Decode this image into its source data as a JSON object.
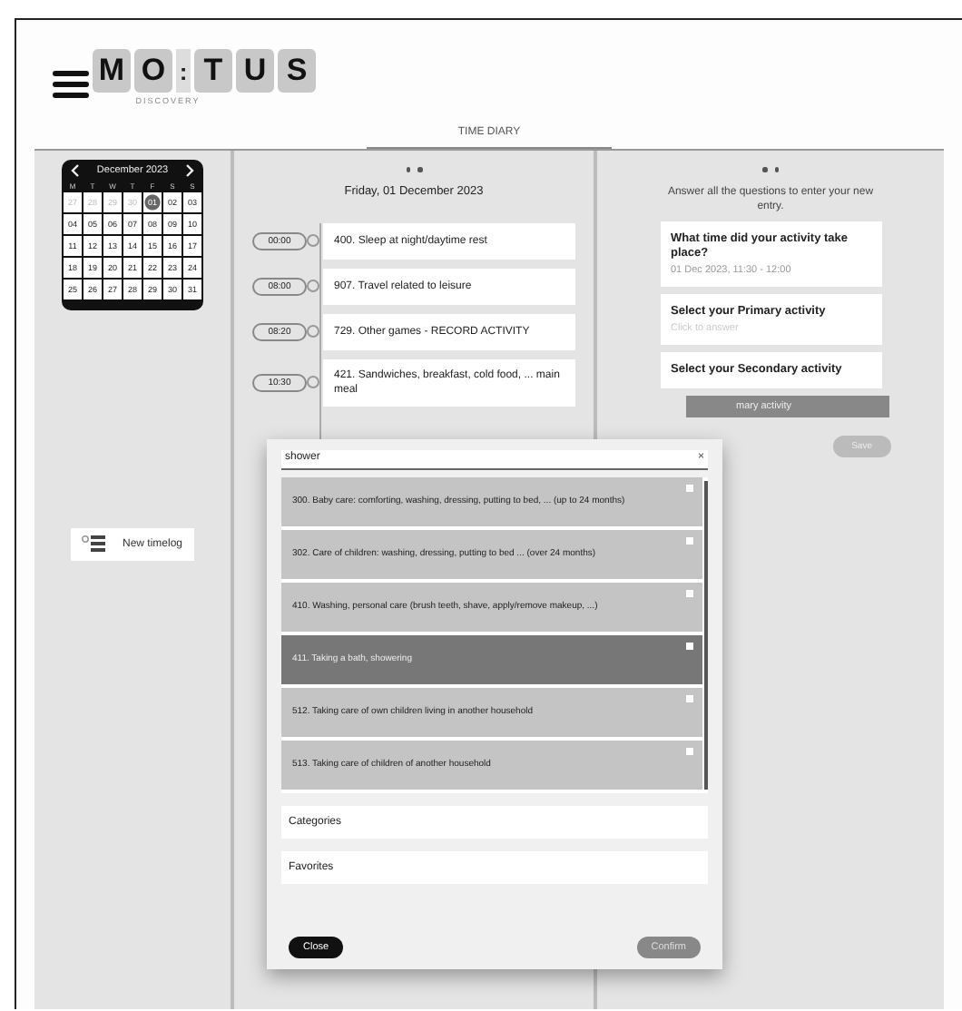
{
  "header": {
    "logo": [
      {
        "kind": "tile",
        "text": "M"
      },
      {
        "kind": "tile",
        "text": "O"
      },
      {
        "kind": "sep",
        "text": ":"
      },
      {
        "kind": "tile",
        "text": "T"
      },
      {
        "kind": "tile",
        "text": "U"
      },
      {
        "kind": "tile",
        "text": "S"
      }
    ],
    "tagline": "DISCOVERY"
  },
  "tabs": [
    {
      "label": "TIME DIARY",
      "selected": true
    }
  ],
  "calendar": {
    "month": "December 2023",
    "weekdays": [
      "M",
      "T",
      "W",
      "T",
      "F",
      "S",
      "S"
    ],
    "weeks": [
      [
        {
          "day": "27",
          "outside": true,
          "selected": false
        },
        {
          "day": "28",
          "outside": true,
          "selected": false
        },
        {
          "day": "29",
          "outside": true,
          "selected": false
        },
        {
          "day": "30",
          "outside": true,
          "selected": false
        },
        {
          "day": "01",
          "outside": false,
          "selected": true
        },
        {
          "day": "02",
          "outside": false,
          "selected": false
        },
        {
          "day": "03",
          "outside": false,
          "selected": false
        }
      ],
      [
        {
          "day": "04",
          "outside": false,
          "selected": false
        },
        {
          "day": "05",
          "outside": false,
          "selected": false
        },
        {
          "day": "06",
          "outside": false,
          "selected": false
        },
        {
          "day": "07",
          "outside": false,
          "selected": false
        },
        {
          "day": "08",
          "outside": false,
          "selected": false
        },
        {
          "day": "09",
          "outside": false,
          "selected": false
        },
        {
          "day": "10",
          "outside": false,
          "selected": false
        }
      ],
      [
        {
          "day": "11",
          "outside": false,
          "selected": false
        },
        {
          "day": "12",
          "outside": false,
          "selected": false
        },
        {
          "day": "13",
          "outside": false,
          "selected": false
        },
        {
          "day": "14",
          "outside": false,
          "selected": false
        },
        {
          "day": "15",
          "outside": false,
          "selected": false
        },
        {
          "day": "16",
          "outside": false,
          "selected": false
        },
        {
          "day": "17",
          "outside": false,
          "selected": false
        }
      ],
      [
        {
          "day": "18",
          "outside": false,
          "selected": false
        },
        {
          "day": "19",
          "outside": false,
          "selected": false
        },
        {
          "day": "20",
          "outside": false,
          "selected": false
        },
        {
          "day": "21",
          "outside": false,
          "selected": false
        },
        {
          "day": "22",
          "outside": false,
          "selected": false
        },
        {
          "day": "23",
          "outside": false,
          "selected": false
        },
        {
          "day": "24",
          "outside": false,
          "selected": false
        }
      ],
      [
        {
          "day": "25",
          "outside": false,
          "selected": false
        },
        {
          "day": "26",
          "outside": false,
          "selected": false
        },
        {
          "day": "27",
          "outside": false,
          "selected": false
        },
        {
          "day": "28",
          "outside": false,
          "selected": false
        },
        {
          "day": "29",
          "outside": false,
          "selected": false
        },
        {
          "day": "30",
          "outside": false,
          "selected": false
        },
        {
          "day": "31",
          "outside": false,
          "selected": false
        }
      ]
    ]
  },
  "new_timelog": {
    "label": "New timelog"
  },
  "timeline": {
    "date": "Friday, 01 December 2023",
    "entries": [
      {
        "time": "00:00",
        "activity": "400. Sleep at night/daytime rest"
      },
      {
        "time": "08:00",
        "activity": "907. Travel related to leisure"
      },
      {
        "time": "08:20",
        "activity": "729. Other games - RECORD ACTIVITY"
      },
      {
        "time": "10:30",
        "activity": "421. Sandwiches, breakfast, cold food, ... main meal"
      }
    ]
  },
  "form": {
    "instruction": "Answer all the questions to enter your new entry.",
    "questions": [
      {
        "question": "What time did your activity take place?",
        "answer": "01 Dec 2023, 11:30 - 12:00",
        "answered": true
      },
      {
        "question": "Select your Primary activity",
        "answer": "Click to answer",
        "answered": false
      },
      {
        "question": "Select your Secondary activity"
      }
    ],
    "bar_label": "mary activity",
    "save": {
      "label": "Save",
      "disabled": true
    }
  },
  "modal": {
    "search": {
      "value": "shower"
    },
    "clear": "×",
    "results": [
      {
        "label": "300. Baby care: comforting, washing, dressing, putting to bed, ... (up to 24 months)",
        "selected": false
      },
      {
        "label": "302. Care of children: washing, dressing, putting to bed ... (over 24 months)",
        "selected": false
      },
      {
        "label": "410. Washing, personal care (brush teeth, shave, apply/remove makeup, ...)",
        "selected": false
      },
      {
        "label": "411. Taking a bath, showering",
        "selected": true
      },
      {
        "label": "512. Taking care of own children living in another household",
        "selected": false
      },
      {
        "label": "513. Taking care of children of another household",
        "selected": false
      }
    ],
    "sections": [
      "Categories",
      "Favorites"
    ],
    "close": {
      "label": "Close"
    },
    "confirm": {
      "label": "Confirm",
      "disabled": true
    }
  }
}
